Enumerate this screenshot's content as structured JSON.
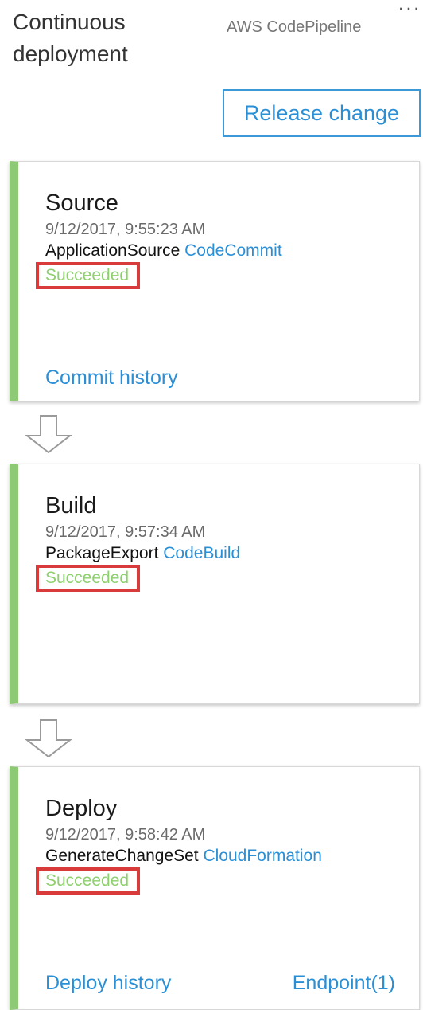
{
  "header": {
    "pipeline_title": "Continuous deployment",
    "provider": "AWS CodePipeline",
    "more_glyph": "···",
    "release_label": "Release change"
  },
  "colors": {
    "accent": "#2b8fd6",
    "success_bar": "#8ec975",
    "success_text": "#8ed06e",
    "highlight_box": "#d93a3a"
  },
  "stages": [
    {
      "name": "Source",
      "time": "9/12/2017, 9:55:23 AM",
      "action": "ApplicationSource",
      "provider": "CodeCommit",
      "status": "Succeeded",
      "links": [
        "Commit history"
      ]
    },
    {
      "name": "Build",
      "time": "9/12/2017, 9:57:34 AM",
      "action": "PackageExport",
      "provider": "CodeBuild",
      "status": "Succeeded",
      "links": []
    },
    {
      "name": "Deploy",
      "time": "9/12/2017, 9:58:42 AM",
      "action": "GenerateChangeSet",
      "provider": "CloudFormation",
      "status": "Succeeded",
      "links": [
        "Deploy history",
        "Endpoint(1)"
      ]
    }
  ],
  "icons": {
    "more": "more-options-icon",
    "transition": "down-arrow-icon"
  }
}
